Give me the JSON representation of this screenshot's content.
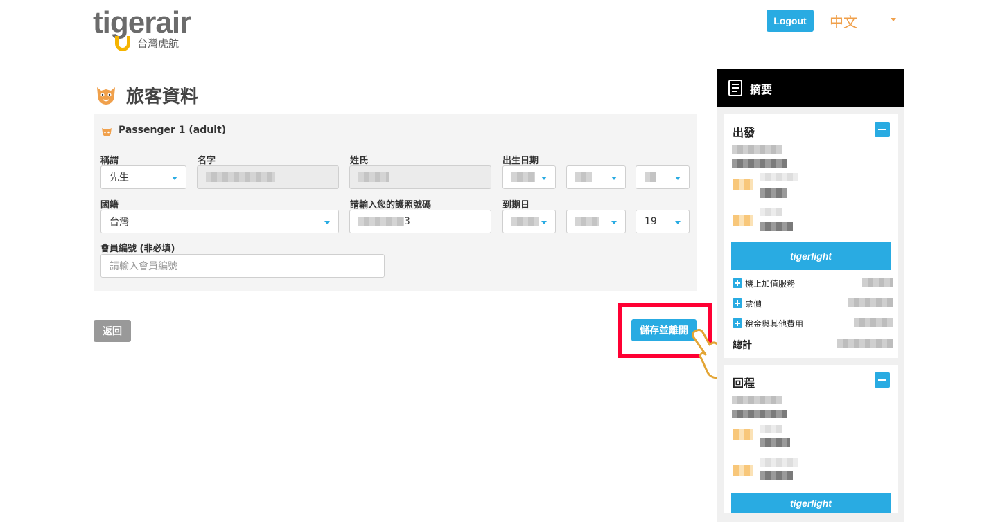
{
  "header": {
    "logo_word": "tigerair",
    "logo_sub": "台灣虎航",
    "logout_label": "Logout",
    "language": "中文"
  },
  "page": {
    "title": "旅客資料"
  },
  "passenger": {
    "heading": "Passenger 1 (adult)",
    "labels": {
      "salutation": "稱謂",
      "first_name": "名字",
      "last_name": "姓氏",
      "birth_date": "出生日期",
      "nationality": "國籍",
      "passport": "請輸入您的護照號碼",
      "expiry": "到期日",
      "member_no": "會員編號 (非必填)"
    },
    "salutation_value": "先生",
    "nationality_value": "台灣",
    "passport_suffix": "3",
    "expiry_day": "19",
    "member_placeholder": "請輸入會員編號"
  },
  "actions": {
    "back_label": "返回",
    "save_label": "儲存並離開"
  },
  "summary": {
    "title": "摘要",
    "departure_title": "出發",
    "return_title": "回程",
    "bundle_label": "tigerlight",
    "fees": {
      "addons": "機上加值服務",
      "fare": "票價",
      "taxes": "稅金與其他費用",
      "total": "總計"
    }
  },
  "colors": {
    "accent": "#29abe2",
    "orange": "#f0a04b",
    "highlight": "#ff0033",
    "back_button": "#999999"
  }
}
